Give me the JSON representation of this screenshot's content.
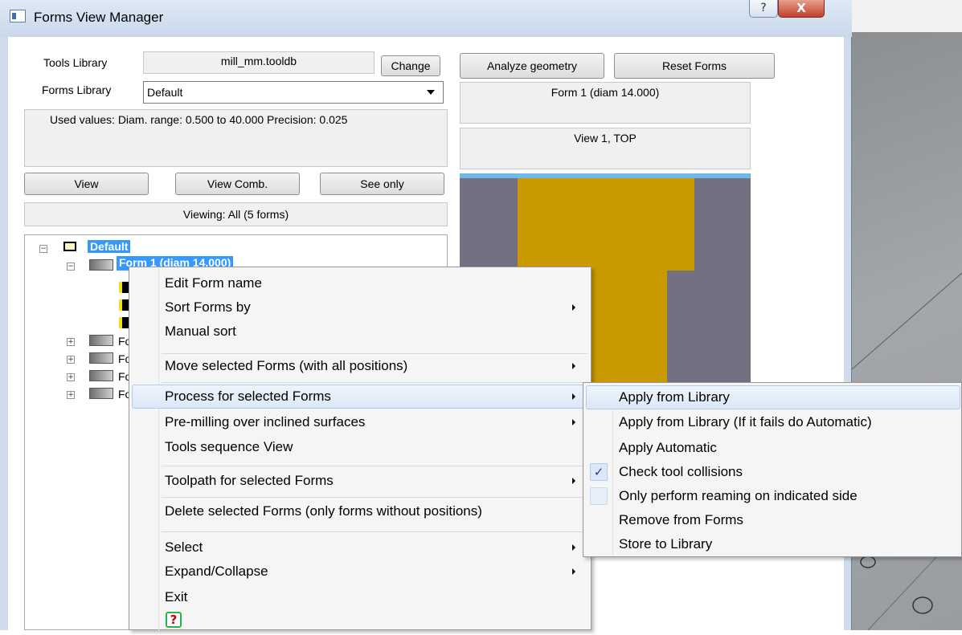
{
  "window": {
    "title": "Forms View Manager",
    "help_label": "?",
    "close_label": "X"
  },
  "tools_library": {
    "label": "Tools Library",
    "value": "mill_mm.tooldb",
    "change_label": "Change"
  },
  "forms_library": {
    "label": "Forms Library",
    "selected": "Default"
  },
  "used_values": "Used values:  Diam. range: 0.500 to 40.000  Precision: 0.025",
  "view_buttons": {
    "view": "View",
    "view_comb": "View Comb.",
    "see_only": "See only"
  },
  "viewing_status": "Viewing: All (5 forms)",
  "top_buttons": {
    "analyze": "Analyze geometry",
    "reset": "Reset Forms"
  },
  "form_info": "Form 1 (diam 14.000)",
  "view_info": "View 1,  TOP",
  "tree": {
    "root_label": "Default",
    "form1_label": "Form 1 (diam 14.000)",
    "collapsed_labels": [
      "Fo",
      "Fo",
      "Fo",
      "Fo"
    ]
  },
  "context_menu": {
    "items": [
      "Edit Form name",
      "Sort Forms by",
      "Manual sort",
      "Move selected Forms (with all positions)",
      "Process for selected Forms",
      "Pre-milling over inclined surfaces",
      "Tools sequence View",
      "Toolpath for selected Forms",
      "Delete selected Forms (only forms without positions)",
      "Select",
      "Expand/Collapse",
      "Exit"
    ],
    "help_icon_label": "?"
  },
  "submenu": {
    "items": [
      "Apply from Library",
      "Apply from Library (If it fails do Automatic)",
      "Apply Automatic",
      "Check tool collisions",
      "Only perform reaming on indicated side",
      "Remove from Forms",
      "Store to Library"
    ],
    "check_tool_collisions_checked": true,
    "only_reaming_checked": false
  },
  "colors": {
    "preview_bg": "#737181",
    "preview_form": "#c99a00",
    "preview_topline": "#6fb9e6",
    "selection": "#3399ff"
  }
}
